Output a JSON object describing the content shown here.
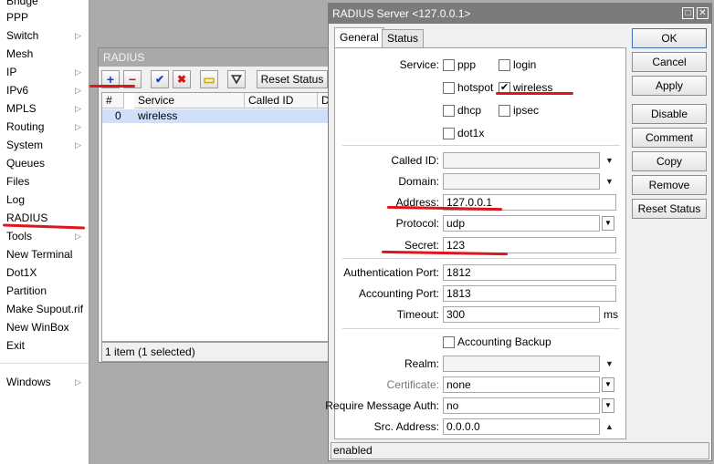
{
  "sidebar": {
    "items": [
      {
        "label": "Bridge",
        "arrow": false
      },
      {
        "label": "PPP",
        "arrow": false
      },
      {
        "label": "Switch",
        "arrow": true
      },
      {
        "label": "Mesh",
        "arrow": false
      },
      {
        "label": "IP",
        "arrow": true
      },
      {
        "label": "IPv6",
        "arrow": true
      },
      {
        "label": "MPLS",
        "arrow": true
      },
      {
        "label": "Routing",
        "arrow": true
      },
      {
        "label": "System",
        "arrow": true
      },
      {
        "label": "Queues",
        "arrow": false
      },
      {
        "label": "Files",
        "arrow": false
      },
      {
        "label": "Log",
        "arrow": false
      },
      {
        "label": "RADIUS",
        "arrow": false
      },
      {
        "label": "Tools",
        "arrow": true
      },
      {
        "label": "New Terminal",
        "arrow": false
      },
      {
        "label": "Dot1X",
        "arrow": false
      },
      {
        "label": "Partition",
        "arrow": false
      },
      {
        "label": "Make Supout.rif",
        "arrow": false
      },
      {
        "label": "New WinBox",
        "arrow": false
      },
      {
        "label": "Exit",
        "arrow": false
      },
      {
        "label": "Windows",
        "arrow": true
      }
    ]
  },
  "radius_window": {
    "title": "RADIUS",
    "toolbar": {
      "add": "+",
      "remove": "−",
      "enable": "✔",
      "disable": "✖",
      "comment": "▭",
      "filter": "⛛",
      "reset_status": "Reset Status"
    },
    "columns": [
      "#",
      "Service",
      "Called ID",
      "D"
    ],
    "rows": [
      {
        "index": "0",
        "service": "wireless"
      }
    ],
    "status": "1 item (1 selected)"
  },
  "dialog": {
    "title": "RADIUS Server <127.0.0.1>",
    "tabs": [
      "General",
      "Status"
    ],
    "service_label": "Service:",
    "services": [
      {
        "name": "ppp",
        "checked": false
      },
      {
        "name": "login",
        "checked": false
      },
      {
        "name": "hotspot",
        "checked": false
      },
      {
        "name": "wireless",
        "checked": true
      },
      {
        "name": "dhcp",
        "checked": false
      },
      {
        "name": "ipsec",
        "checked": false
      },
      {
        "name": "dot1x",
        "checked": false
      }
    ],
    "labels": {
      "called_id": "Called ID:",
      "domain": "Domain:",
      "address": "Address:",
      "protocol": "Protocol:",
      "secret": "Secret:",
      "auth_port": "Authentication Port:",
      "acct_port": "Accounting Port:",
      "timeout": "Timeout:",
      "accounting_backup": "Accounting Backup",
      "realm": "Realm:",
      "certificate": "Certificate:",
      "require_msg_auth": "Require Message Auth:",
      "src_address": "Src. Address:"
    },
    "values": {
      "called_id": "",
      "domain": "",
      "address": "127.0.0.1",
      "protocol": "udp",
      "secret": "123",
      "auth_port": "1812",
      "acct_port": "1813",
      "timeout": "300",
      "timeout_unit": "ms",
      "accounting_backup": false,
      "realm": "",
      "certificate": "none",
      "require_msg_auth": "no",
      "src_address": "0.0.0.0"
    },
    "buttons": [
      "OK",
      "Cancel",
      "Apply",
      "Disable",
      "Comment",
      "Copy",
      "Remove",
      "Reset Status"
    ],
    "status": "enabled"
  },
  "colors": {
    "annotation": "#e0151c",
    "title_bar": "#7b7b7b",
    "selection": "#cfe0f8"
  }
}
